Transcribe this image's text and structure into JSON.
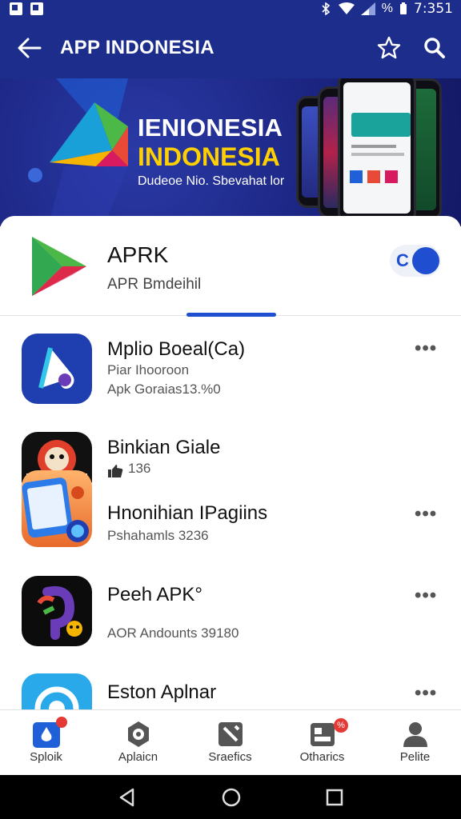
{
  "status_bar": {
    "battery": "%",
    "time": "7:351"
  },
  "app_bar": {
    "title": "APP INDONESIA"
  },
  "banner": {
    "headline_1": "IENIONESIA",
    "headline_2": "INDONESIA",
    "subtitle": "Dudeoe Nio. Sbevahat lor"
  },
  "featured": {
    "name": "APRK",
    "subtitle": "APR Bmdeihil",
    "toggle_on": true,
    "colors": {
      "accent": "#1f4fd0"
    }
  },
  "apps": [
    {
      "name": "Mplio Boeal(Ca)",
      "meta_1": "Piar Ihooroon",
      "meta_2": "Apk Goraias13.%0",
      "icon": "map-pin-app-icon"
    },
    {
      "name": "Binkian Giale",
      "meta_1": "136",
      "icon": "game-character-app-icon"
    },
    {
      "name": "Hnonihian IPagiins",
      "meta_1": "Pshahamls 3236",
      "icon": "tablet-app-icon"
    },
    {
      "name": "Peeh APK°",
      "meta_1": "AOR Andounts 39180",
      "icon": "paint-app-icon"
    },
    {
      "name": "Eston Aplnar",
      "icon": "blue-app-icon"
    }
  ],
  "bottom_nav": [
    {
      "label": "Sploik",
      "icon": "home-icon",
      "active": true,
      "badge": true
    },
    {
      "label": "Aplaicn",
      "icon": "apps-gear-icon",
      "active": false
    },
    {
      "label": "Sraefics",
      "icon": "tools-icon",
      "active": false
    },
    {
      "label": "Otharics",
      "icon": "games-icon",
      "active": false,
      "badge_text": "%"
    },
    {
      "label": "Pelite",
      "icon": "profile-icon",
      "active": false
    }
  ]
}
